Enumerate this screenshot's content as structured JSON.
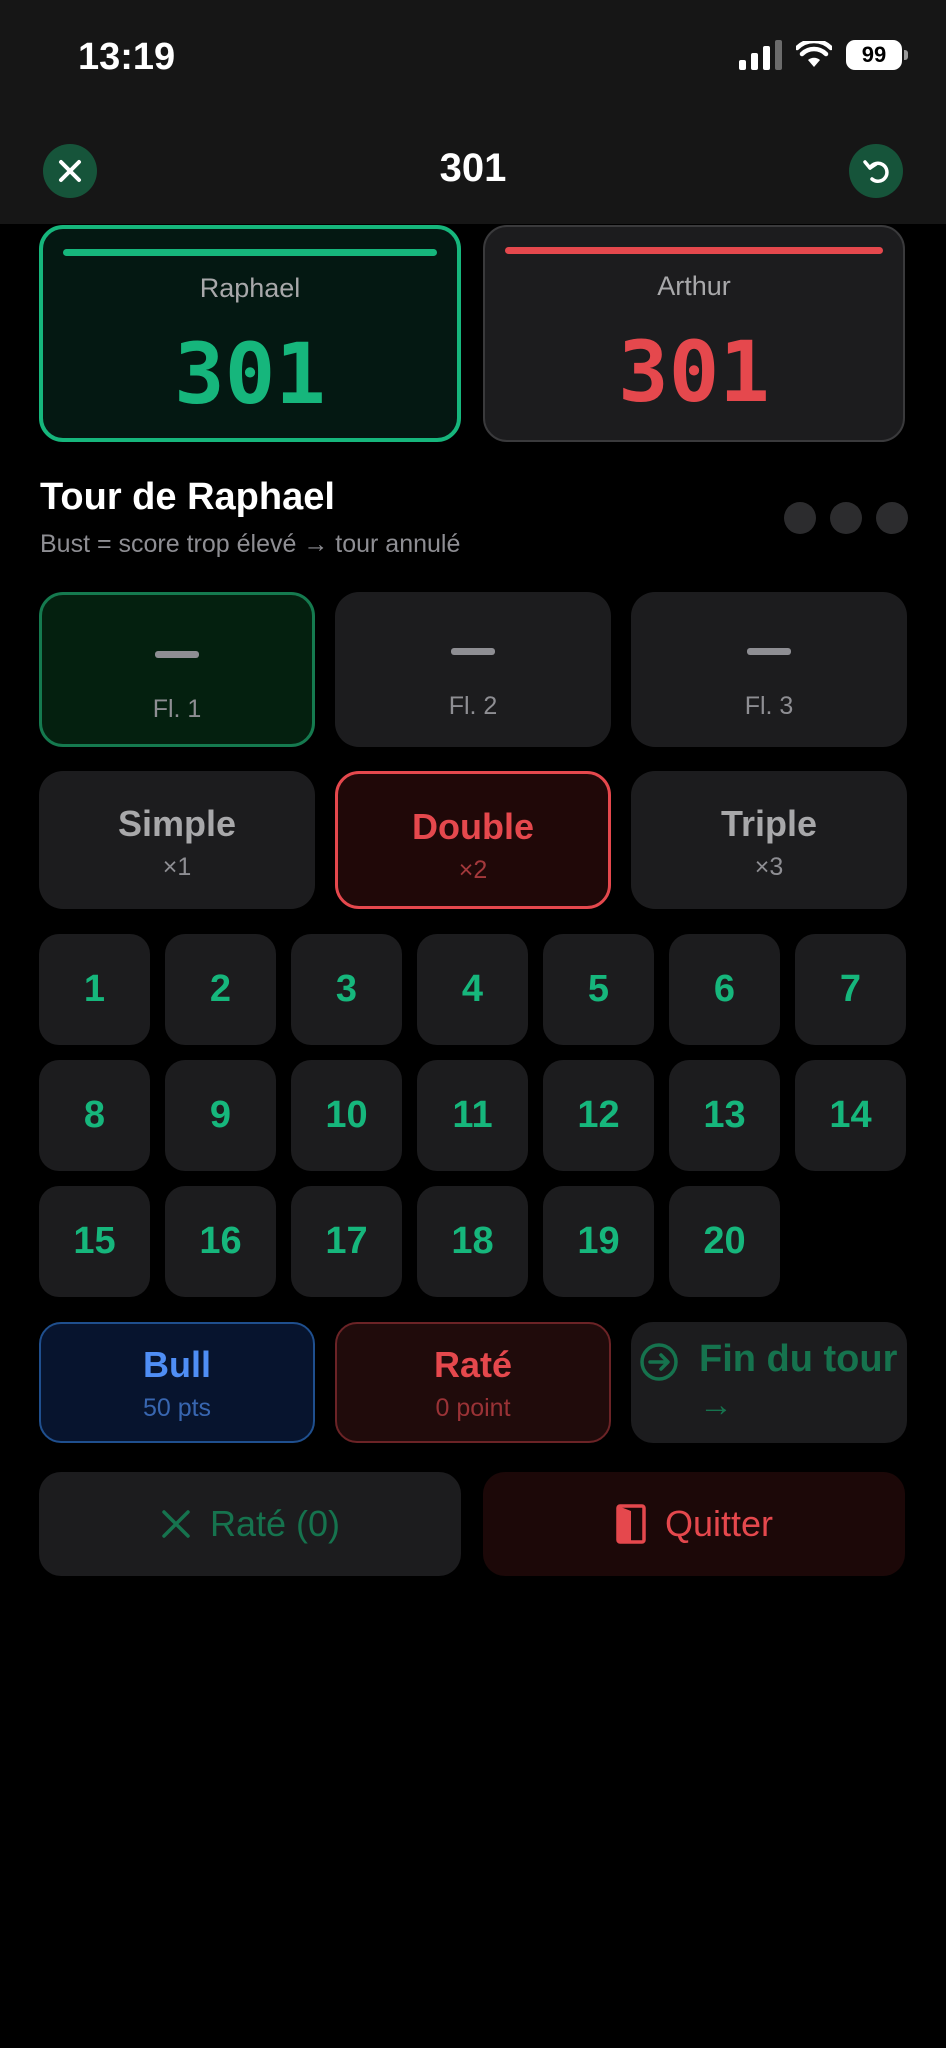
{
  "status_bar": {
    "time": "13:19",
    "battery": "99"
  },
  "nav": {
    "title": "301",
    "close_icon": "close-icon",
    "undo_icon": "undo-icon"
  },
  "players": [
    {
      "name": "Raphael",
      "score": "301",
      "color": "#16b67c",
      "active": true
    },
    {
      "name": "Arthur",
      "score": "301",
      "color": "#e5484d",
      "active": false
    }
  ],
  "turn": {
    "title": "Tour de Raphael",
    "subtitle": "Bust = score trop élevé → tour annulé",
    "darts_thrown": 0
  },
  "darts": [
    {
      "label": "Fl. 1",
      "value": "—",
      "active": true
    },
    {
      "label": "Fl. 2",
      "value": "—",
      "active": false
    },
    {
      "label": "Fl. 3",
      "value": "—",
      "active": false
    }
  ],
  "multipliers": [
    {
      "name": "Simple",
      "factor": "×1",
      "selected": false
    },
    {
      "name": "Double",
      "factor": "×2",
      "selected": true
    },
    {
      "name": "Triple",
      "factor": "×3",
      "selected": false
    }
  ],
  "numbers": [
    "1",
    "2",
    "3",
    "4",
    "5",
    "6",
    "7",
    "8",
    "9",
    "10",
    "11",
    "12",
    "13",
    "14",
    "15",
    "16",
    "17",
    "18",
    "19",
    "20"
  ],
  "special": {
    "bull": {
      "name": "Bull",
      "sub": "50 pts"
    },
    "miss": {
      "name": "Raté",
      "sub": "0 point"
    },
    "end_turn": {
      "label": "Fin du tour",
      "arrow": "→"
    }
  },
  "actions": {
    "miss_count": "Raté (0)",
    "quit": "Quitter"
  },
  "colors": {
    "accent_green": "#16b67c",
    "accent_red": "#e5484d",
    "accent_blue": "#4f8ef5",
    "surface": "#1c1c1e"
  }
}
